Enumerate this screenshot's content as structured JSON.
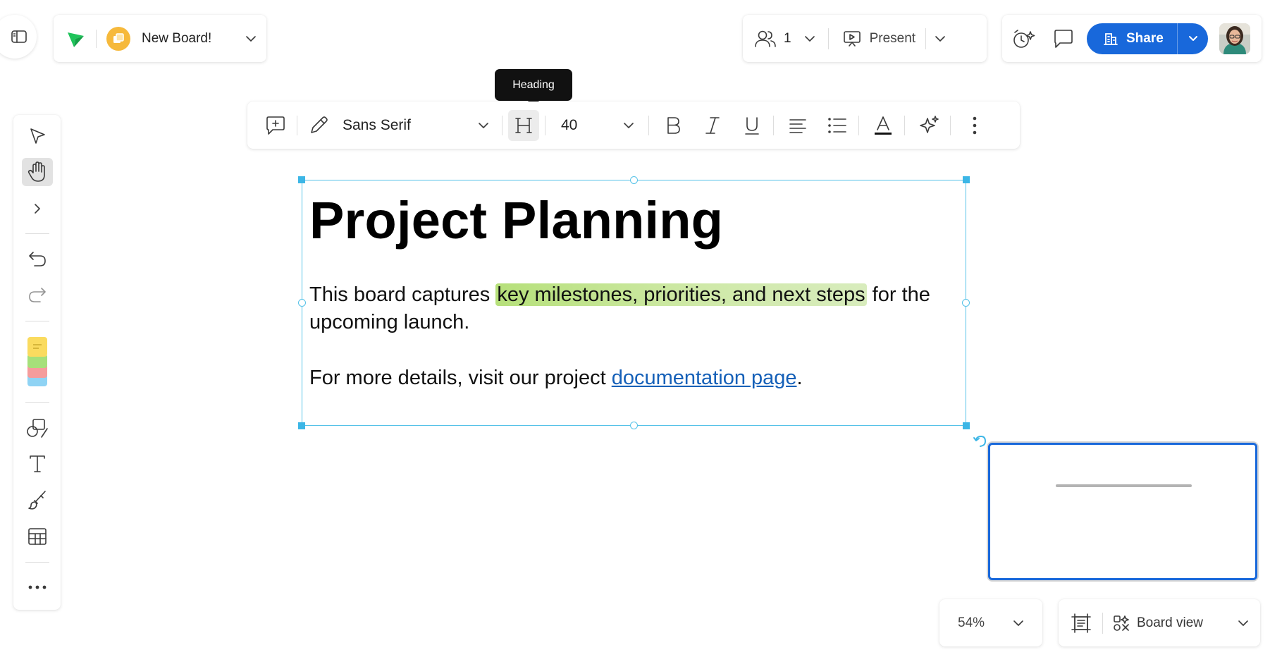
{
  "header": {
    "board_name": "New Board!"
  },
  "collaborators": {
    "count": "1",
    "present_label": "Present"
  },
  "share": {
    "label": "Share"
  },
  "tooltip": {
    "text": "Heading"
  },
  "text_toolbar": {
    "font_family": "Sans Serif",
    "font_size": "40",
    "active_tool": "heading"
  },
  "canvas": {
    "heading": "Project Planning",
    "para1_before": "This board captures ",
    "para1_highlight": "key milestones, priorities, and next steps",
    "para1_after": " for the upcoming launch.",
    "para2_before": "For more details, visit our project ",
    "para2_link": "documentation page",
    "para2_after": "."
  },
  "footer": {
    "zoom": "54%",
    "view_label": "Board view"
  },
  "colors": {
    "accent": "#1868db",
    "selection": "#55c2e8",
    "highlight": "#c3e592",
    "board_icon": "#f6b93b",
    "logo": "#1fc45b"
  }
}
